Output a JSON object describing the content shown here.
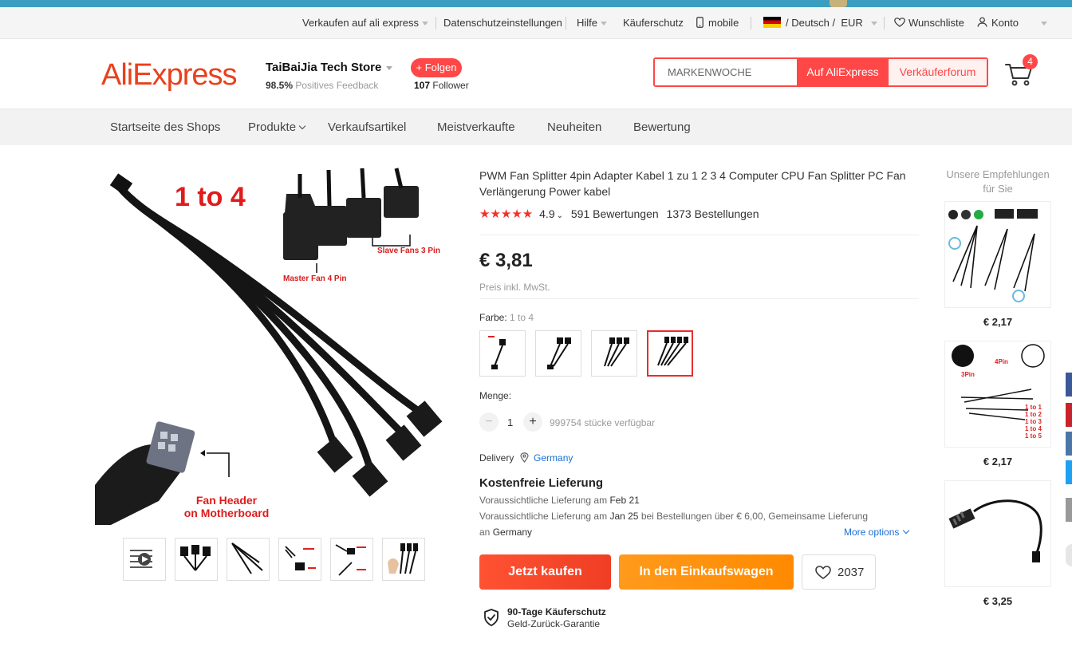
{
  "utility_bar": {
    "sell": "Verkaufen auf ali express",
    "privacy": "Datenschutzeinstellungen",
    "help": "Hilfe",
    "buyer_protection": "Käuferschutz",
    "mobile": "mobile",
    "locale": "/ Deutsch /",
    "currency": "EUR",
    "wishlist": "Wunschliste",
    "account": "Konto"
  },
  "header": {
    "logo": "AliExpress",
    "store_name": "TaiBaiJia Tech Store",
    "feedback_percent": "98.5%",
    "feedback_label": "Positives Feedback",
    "follow_button": "+ Folgen",
    "follower_count": "107",
    "follower_label": "Follower",
    "search_placeholder": "MARKENWOCHE",
    "search_button": "Auf AliExpress",
    "forum_button": "Verkäuferforum",
    "cart_count": "4"
  },
  "shop_nav": {
    "items": [
      "Startseite des Shops",
      "Produkte",
      "Verkaufsartikel",
      "Meistverkaufte",
      "Neuheiten",
      "Bewertung"
    ]
  },
  "gallery": {
    "main_heading": "1 to 4",
    "slave_label": "Slave Fans 3 Pin",
    "master_label": "Master Fan 4 Pin",
    "header_label_1": "Fan Header",
    "header_label_2": "on Motherboard"
  },
  "product": {
    "title": "PWM Fan Splitter 4pin Adapter Kabel 1 zu 1 2 3 4 Computer CPU Fan Splitter PC Fan Verlängerung Power kabel",
    "rating": "4.9",
    "reviews": "591 Bewertungen",
    "orders": "1373 Bestellungen",
    "price": "€ 3,81",
    "tax_note": "Preis inkl. MwSt.",
    "color_label": "Farbe:",
    "color_selected": "1 to 4",
    "quantity_label": "Menge:",
    "quantity": "1",
    "available": "999754 stücke verfügbar",
    "delivery_label": "Delivery",
    "delivery_country": "Germany",
    "shipping_title": "Kostenfreie Lieferung",
    "ship_line1_prefix": "Voraussichtliche Lieferung am",
    "ship_line1_date": "Feb 21",
    "ship_line2_prefix": "Voraussichtliche Lieferung am",
    "ship_line2_date": "Jan 25",
    "ship_line2_suffix": "bei Bestellungen über € 6,00, Gemeinsame Lieferung",
    "ship_line3_prefix": "an",
    "ship_line3_country": "Germany",
    "more_options": "More options",
    "buy_now": "Jetzt kaufen",
    "add_to_cart": "In den Einkaufswagen",
    "wish_count": "2037",
    "protection_title": "90-Tage Käuferschutz",
    "protection_sub": "Geld-Zurück-Garantie"
  },
  "recommendations": {
    "heading": "Unsere Empfehlungen für Sie",
    "prices": [
      "€ 2,17",
      "€ 2,17",
      "€ 3,25"
    ]
  },
  "colors": {
    "brand_red": "#ff4747",
    "buy_orange_red": "#ef3e24",
    "cart_orange": "#ff8a00",
    "link_blue": "#1b6fd1",
    "star_red": "#f5302a"
  }
}
